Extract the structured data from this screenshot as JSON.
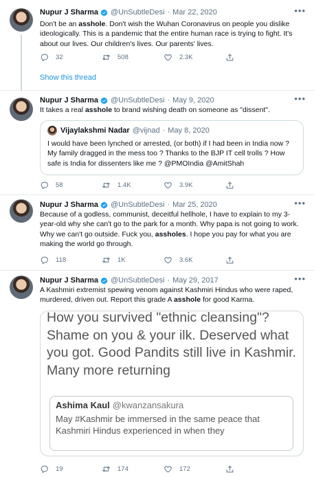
{
  "author": {
    "name": "Nupur J Sharma",
    "handle": "@UnSubtleDesi"
  },
  "colors": {
    "verified": "#1da1f2",
    "link": "#1b95e0",
    "muted": "#5b7083",
    "divider": "#e6ecf0"
  },
  "tweets": [
    {
      "date": "Mar 22, 2020",
      "text": [
        "Don't be an ",
        "asshole",
        ". Don't wish the Wuhan Coronavirus on people you dislike ideologically. This is a pandemic that the entire human race is trying to fight. It's about our lives. Our children's lives. Our parents' lives."
      ],
      "replies": "32",
      "retweets": "508",
      "likes": "2.3K",
      "show_thread": "Show this thread"
    },
    {
      "date": "May 9, 2020",
      "text": [
        "It takes a real ",
        "asshole",
        " to brand wishing death on someone as \"dissent\"."
      ],
      "quote": {
        "name": "Vijaylakshmi Nadar",
        "handle": "@vijnad",
        "date": "May 8, 2020",
        "text": "I would have been lynched or arrested, (or both) if I had been in India now ? My family dragged in the mess too ?  Thanks to the BJP IT cell trolls ? How safe is India for dissenters like me ?  @PMOIndia @AmitShah"
      },
      "replies": "58",
      "retweets": "1.4K",
      "likes": "3.9K"
    },
    {
      "date": "Mar 25, 2020",
      "text": [
        "Because of a godless, communist, deceitful hellhole, I have to explain to my 3-year-old why she can't go to the park for a month. Why papa is not going to work. Why we can't go outside. Fuck you, ",
        "assholes",
        ". I hope you pay for what you are making the world go through."
      ],
      "replies": "118",
      "retweets": "1K",
      "likes": "3.6K"
    },
    {
      "date": "May 29, 2017",
      "text": [
        "A Kashmiri extremist spewing venom against Kashmiri Hindus who were raped, murdered, driven out. Report this grade A ",
        "asshole",
        " for good Karma."
      ],
      "image": {
        "text": "How you survived \"ethnic cleansing\"? Shame on you & your ilk. Deserved what you got. Good Pandits still live in Kashmir. Many more returning",
        "quoted_name": "Ashima Kaul",
        "quoted_handle": "@kwanzansakura",
        "quoted_text": "May #Kashmir be immersed in the same peace that Kashmiri Hindus experienced in when they"
      },
      "replies": "19",
      "retweets": "174",
      "likes": "172"
    }
  ]
}
